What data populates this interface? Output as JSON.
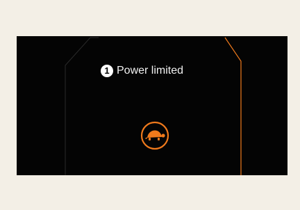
{
  "alert": {
    "badge": "1",
    "message": "Power limited"
  },
  "icons": {
    "limited_power": "turtle-icon"
  },
  "colors": {
    "page_background": "#f3efe6",
    "screen_background": "#040404",
    "accent": "#f07a1c",
    "text": "#f2f2f2"
  }
}
